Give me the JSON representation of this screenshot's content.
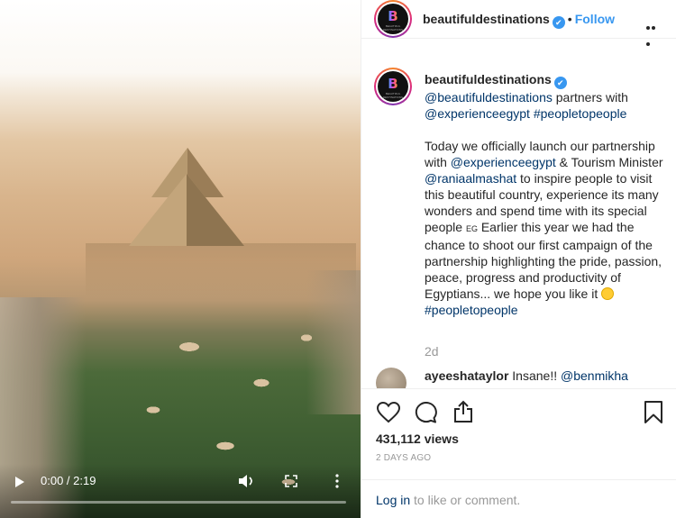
{
  "video": {
    "time_display": "0:00 / 2:19",
    "progress_fraction": 0.0
  },
  "header": {
    "username": "beautifuldestinations",
    "verified_mark": "✔",
    "separator": "•",
    "follow_label": "Follow"
  },
  "caption": {
    "username": "beautifuldestinations",
    "mention_self": "@beautifuldestinations",
    "line1_rest": " partners with",
    "mention_partner": "@experienceegypt",
    "hashtag": "#peopletopeople",
    "p2_start": "Today we officially launch our partnership with ",
    "p2_mention1": "@experienceegypt",
    "p2_mid": " & Tourism Minister ",
    "p2_mention2": "@raniaalmashat",
    "p2_rest": " to inspire people to visit this beautiful country, experience its many wonders and spend time with its special people ",
    "flag_text": "EG",
    "p2_end": " Earlier this year we had the chance to shoot our first campaign of the partnership highlighting the pride, passion, peace, progress and productivity of Egyptians... we hope you like it ",
    "p2_hashtag": "#peopletopeople",
    "time_ago": "2d"
  },
  "comment": {
    "username": "ayeeshataylor",
    "text": " Insane!! ",
    "mention": "@benmikha"
  },
  "stats": {
    "views": "431,112 views",
    "posted": "2 DAYS AGO"
  },
  "login": {
    "link": "Log in",
    "rest": " to like or comment."
  },
  "avatar": {
    "letter": "B",
    "tagline": "BEAUTIFUL DESTINATIONS"
  },
  "colors": {
    "link": "#003569",
    "follow": "#3897f0",
    "verified": "#3897f0",
    "muted": "#999999"
  }
}
